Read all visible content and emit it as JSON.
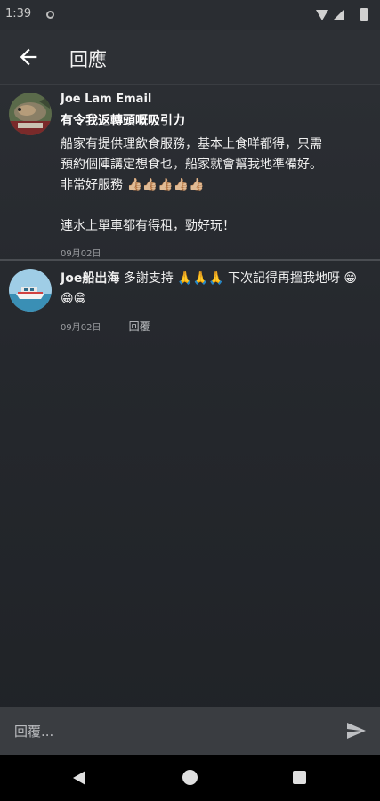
{
  "status_bar": {
    "time": "1:39"
  },
  "toolbar": {
    "title": "回應"
  },
  "comments": [
    {
      "author": "Joe Lam Email",
      "title": "有令我返轉頭嘅吸引力",
      "lines": [
        "船家有提供理飲食服務，基本上食咩都得，只需",
        "預約個陣講定想食乜，船家就會幫我地準備好。",
        "非常好服務 👍🏼👍🏼👍🏼👍🏼👍🏼",
        "",
        "連水上單車都有得租，勁好玩！"
      ],
      "date": "09月02日"
    },
    {
      "author": "Joe船出海",
      "text": " 多謝支持 🙏🙏🙏 下次記得再搵我地呀 😁😁😁",
      "date": "09月02日",
      "reply_label": "回覆"
    }
  ],
  "reply_bar": {
    "placeholder": "回覆..."
  }
}
